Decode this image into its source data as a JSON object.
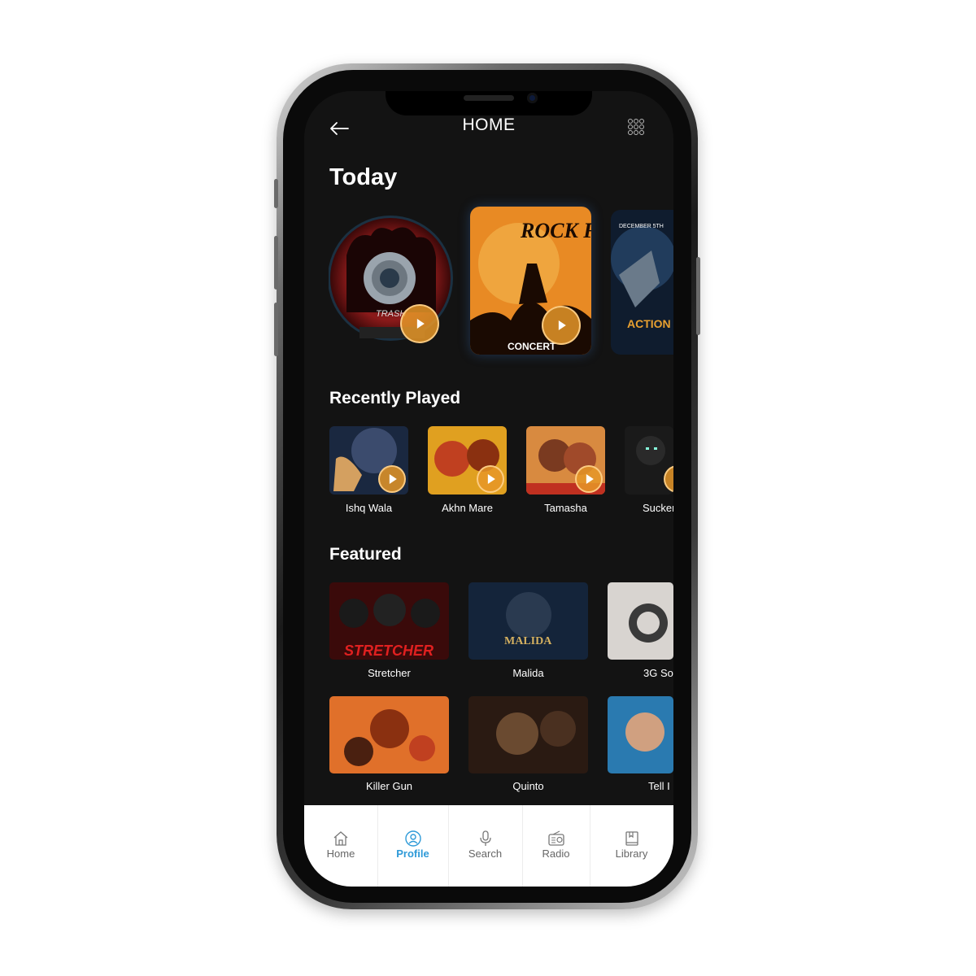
{
  "header": {
    "title": "HOME"
  },
  "today": {
    "title": "Today",
    "cards": [
      {
        "name": "cd-disc-art",
        "art_text": "TRASH"
      },
      {
        "name": "rock-festival-poster",
        "art_text": "ROCK FESTIVAL",
        "art_subtext": "CONCERT"
      },
      {
        "name": "action-jack-poster",
        "art_text": "DECEMBER 5TH",
        "art_subtext": "ACTION JACK"
      }
    ]
  },
  "recently_played": {
    "title": "Recently Played",
    "items": [
      {
        "label": "Ishq Wala"
      },
      {
        "label": "Akhn Mare"
      },
      {
        "label": "Tamasha"
      },
      {
        "label": "Sucker"
      }
    ]
  },
  "featured": {
    "title": "Featured",
    "items": [
      {
        "label": "Stretcher",
        "art_text": "STRETCHER"
      },
      {
        "label": "Malida",
        "art_text": "MALIDA"
      },
      {
        "label": "3G So"
      },
      {
        "label": "Killer Gun"
      },
      {
        "label": "Quinto"
      },
      {
        "label": "Tell I"
      }
    ]
  },
  "tabbar": {
    "tabs": [
      {
        "label": "Home",
        "icon": "home-icon",
        "active": false
      },
      {
        "label": "Profile",
        "icon": "profile-icon",
        "active": true
      },
      {
        "label": "Search",
        "icon": "mic-icon",
        "active": false
      },
      {
        "label": "Radio",
        "icon": "radio-icon",
        "active": false
      },
      {
        "label": "Library",
        "icon": "book-icon",
        "active": false
      }
    ]
  },
  "colors": {
    "accent": "#2e9ad8",
    "play": "#e89a2a",
    "background": "#131313"
  }
}
